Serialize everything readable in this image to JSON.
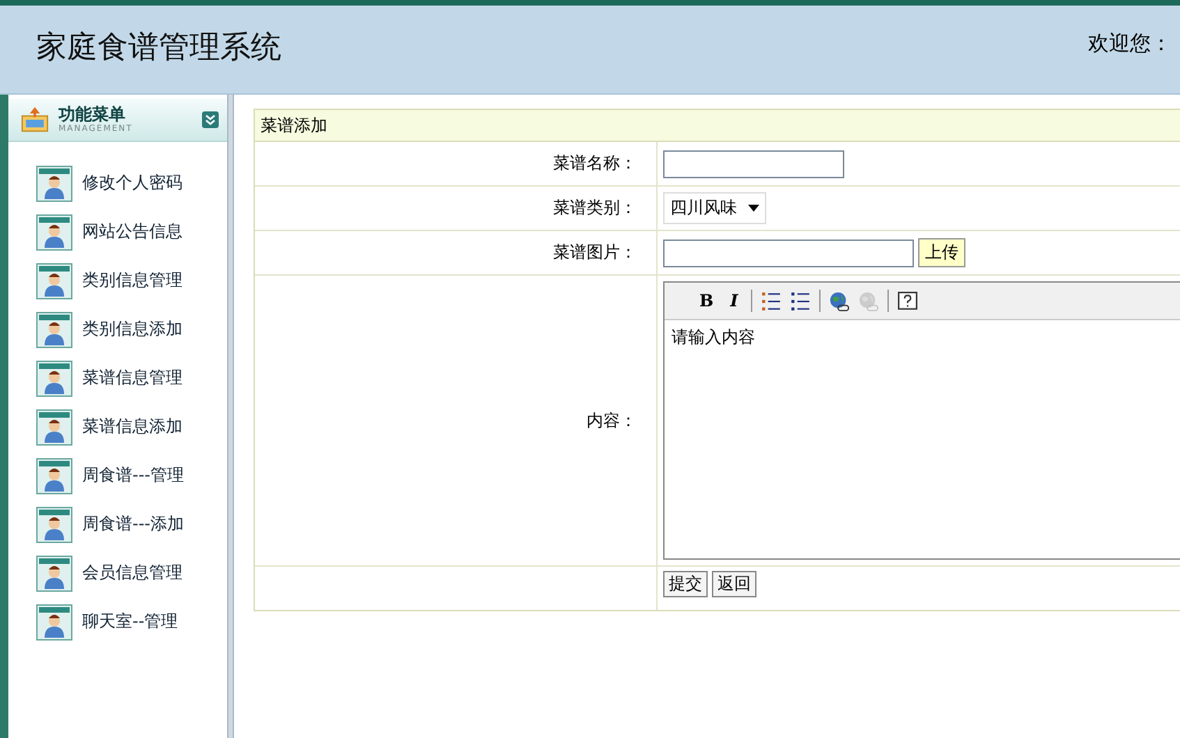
{
  "header": {
    "title": "家庭食谱管理系统",
    "welcome": "欢迎您："
  },
  "menu": {
    "title": "功能菜单",
    "subtitle": "MANAGEMENT",
    "items": [
      "修改个人密码",
      "网站公告信息",
      "类别信息管理",
      "类别信息添加",
      "菜谱信息管理",
      "菜谱信息添加",
      "周食谱---管理",
      "周食谱---添加",
      "会员信息管理",
      "聊天室--管理"
    ]
  },
  "form": {
    "title": "菜谱添加",
    "fields": [
      {
        "kind": "text",
        "label": "菜谱名称："
      },
      {
        "kind": "select",
        "label": "菜谱类别：",
        "value": "四川风味"
      },
      {
        "kind": "upload",
        "label": "菜谱图片：",
        "button": "上传"
      },
      {
        "kind": "editor",
        "label": "内容：",
        "value": "请输入内容",
        "tools": [
          {
            "kind": "bold",
            "label": "B",
            "disabled": false
          },
          {
            "kind": "italic",
            "label": "I",
            "disabled": false
          },
          {
            "kind": "ordered-list",
            "disabled": false
          },
          {
            "kind": "bullet-list",
            "disabled": false
          },
          {
            "kind": "link",
            "disabled": false
          },
          {
            "kind": "unlink",
            "disabled": true
          },
          {
            "kind": "help",
            "disabled": false
          }
        ]
      }
    ],
    "buttons": [
      "提交",
      "返回"
    ]
  }
}
